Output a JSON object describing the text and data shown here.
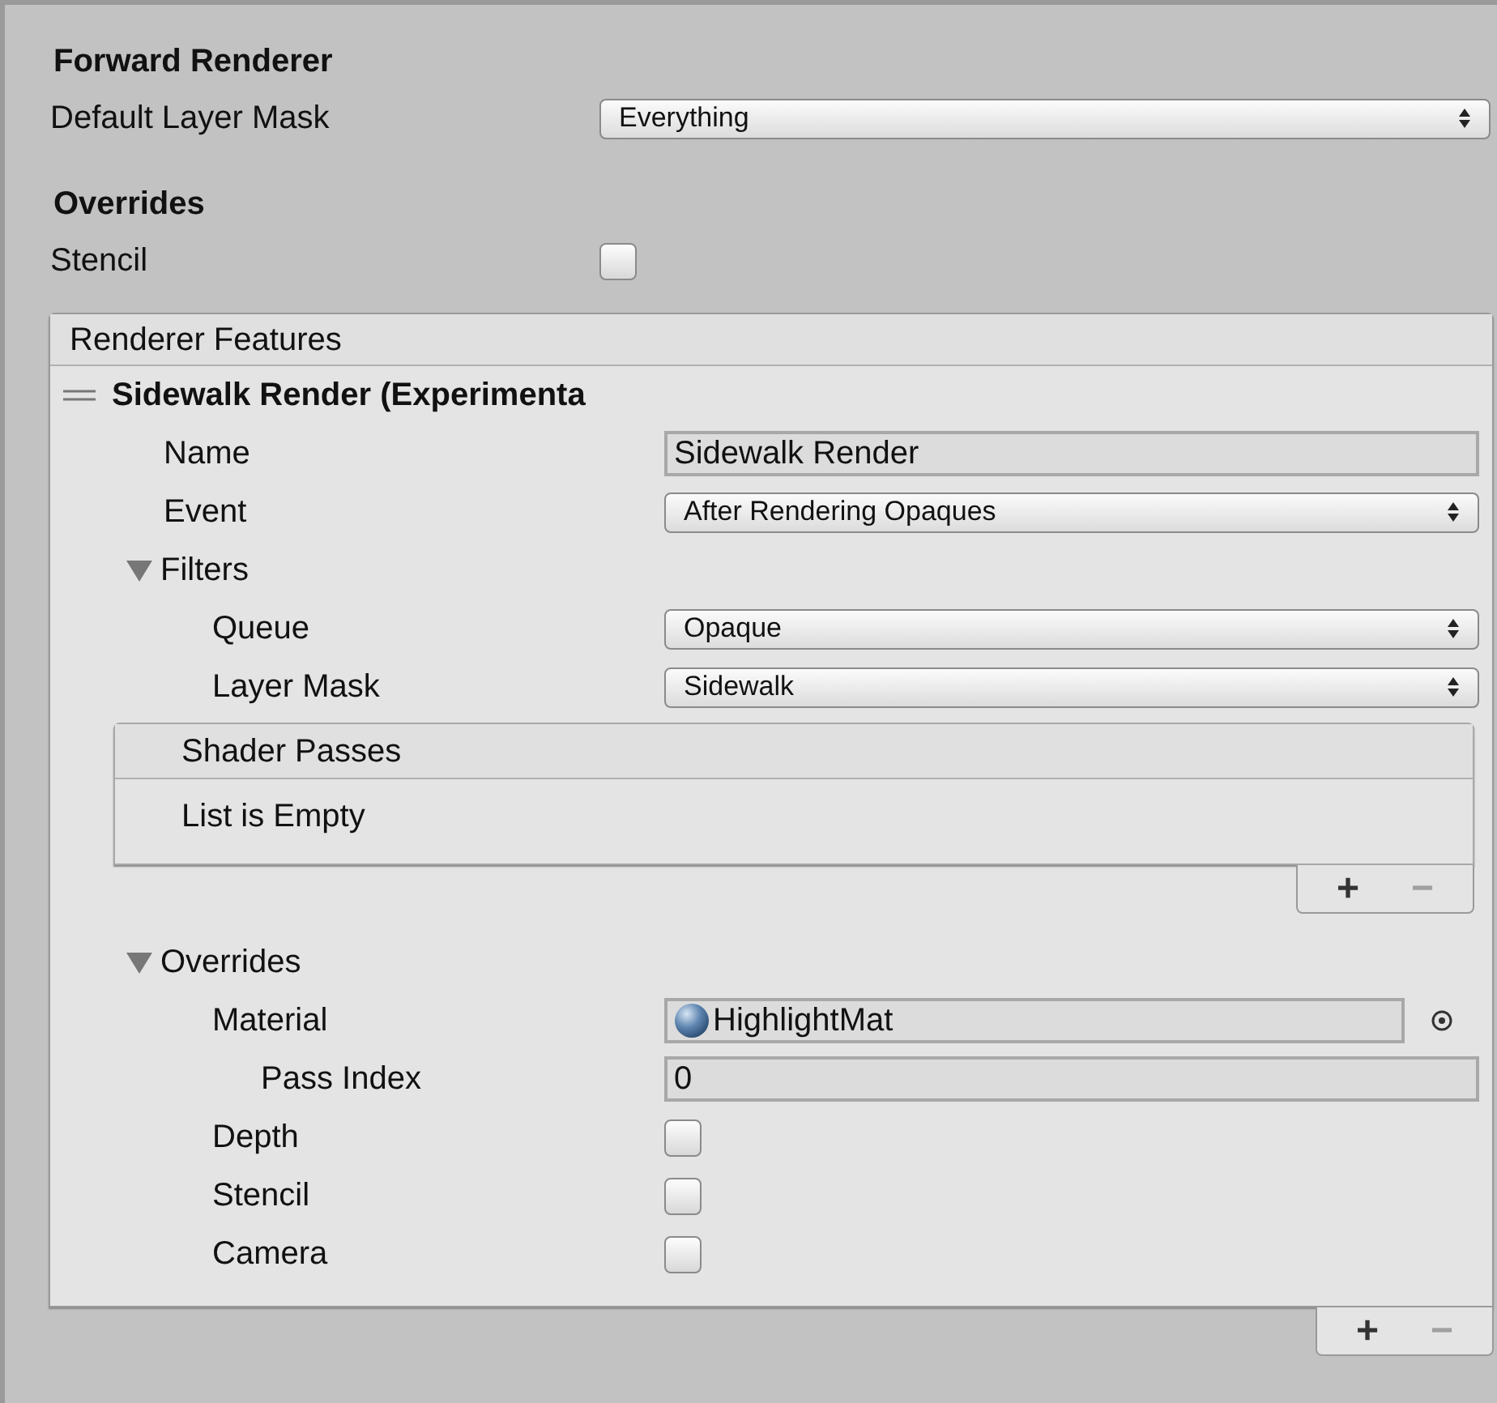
{
  "heading": "Forward Renderer",
  "fields": [
    {
      "label": "Default Layer Mask",
      "kind": "dropdown",
      "value": "Everything"
    }
  ],
  "overrides_heading": "Overrides",
  "override_fields": [
    {
      "label": "Stencil",
      "kind": "checkbox",
      "checked": false
    }
  ],
  "renderer_features": {
    "header": "Renderer Features",
    "features": [
      {
        "title": "Sidewalk Render (Experimenta",
        "properties": [
          {
            "label": "Name",
            "kind": "text",
            "value": "Sidewalk Render"
          },
          {
            "label": "Event",
            "kind": "dropdown",
            "value": "After Rendering Opaques"
          },
          {
            "label": "Filters",
            "kind": "foldout",
            "expanded": true,
            "children": [
              {
                "label": "Queue",
                "kind": "dropdown",
                "value": "Opaque"
              },
              {
                "label": "Layer Mask",
                "kind": "dropdown",
                "value": "Sidewalk"
              },
              {
                "label": "Shader Passes",
                "kind": "list",
                "empty_text": "List is Empty",
                "footer_buttons": [
                  "+",
                  "−"
                ]
              }
            ]
          },
          {
            "label": "Overrides",
            "kind": "foldout",
            "expanded": true,
            "children": [
              {
                "label": "Material",
                "kind": "object",
                "value": "HighlightMat",
                "children": [
                  {
                    "label": "Pass Index",
                    "kind": "text",
                    "value": "0"
                  }
                ]
              },
              {
                "label": "Depth",
                "kind": "checkbox",
                "checked": false
              },
              {
                "label": "Stencil",
                "kind": "checkbox",
                "checked": false
              },
              {
                "label": "Camera",
                "kind": "checkbox",
                "checked": false
              }
            ]
          }
        ]
      }
    ],
    "footer_buttons": [
      "+",
      "−"
    ]
  }
}
